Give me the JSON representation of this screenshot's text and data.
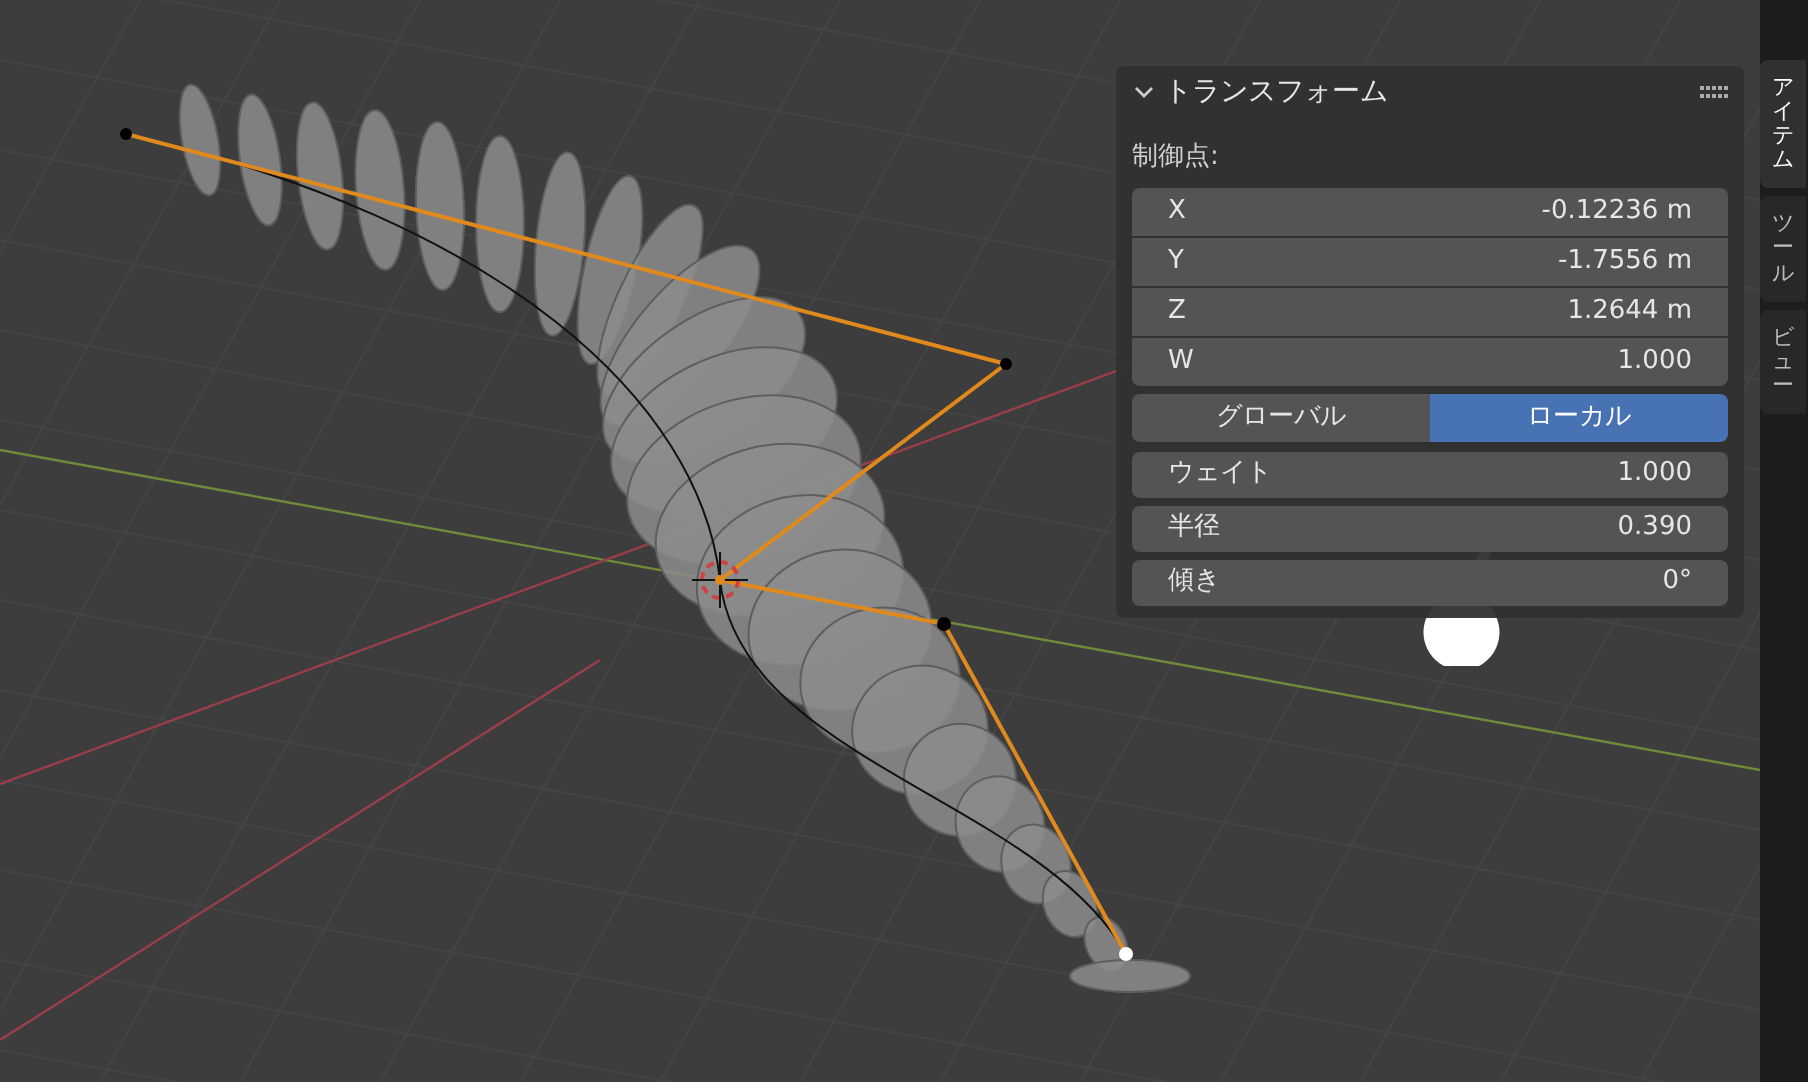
{
  "panel": {
    "title": "トランスフォーム",
    "expanded": true,
    "section_label": "制御点:",
    "coordinates": [
      {
        "label": "X",
        "value": "-0.12236 m"
      },
      {
        "label": "Y",
        "value": "-1.7556 m"
      },
      {
        "label": "Z",
        "value": "1.2644 m"
      },
      {
        "label": "W",
        "value": "1.000"
      }
    ],
    "space_toggle": [
      {
        "label": "グローバル",
        "selected": false
      },
      {
        "label": "ローカル",
        "selected": true
      }
    ],
    "properties": [
      {
        "label": "ウェイト",
        "value": "1.000"
      },
      {
        "label": "半径",
        "value": "0.390"
      },
      {
        "label": "傾き",
        "value": "0°"
      }
    ]
  },
  "sidebar_tabs": [
    {
      "label": "アイテム",
      "selected": true
    },
    {
      "label": "ツール",
      "selected": false
    },
    {
      "label": "ビュー",
      "selected": false
    }
  ]
}
